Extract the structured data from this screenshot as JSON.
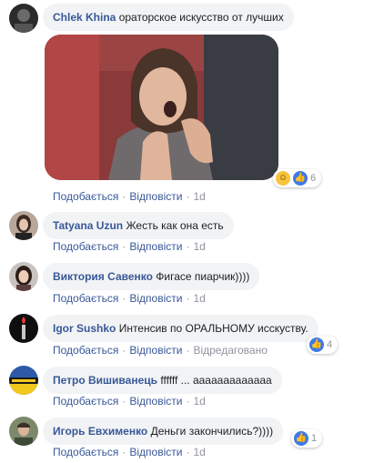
{
  "comments": [
    {
      "author": "Chlek Khina",
      "text": "ораторское искусство от лучших",
      "like_label": "Подобається",
      "reply_label": "Відповісти",
      "time": "1d",
      "reactions_count": "6",
      "reaction_icons": [
        "haha-icon",
        "like-icon"
      ]
    },
    {
      "author": "Tatyana Uzun",
      "text": "Жесть как она есть",
      "like_label": "Подобається",
      "reply_label": "Відповісти",
      "time": "1d"
    },
    {
      "author": "Виктория Савенко",
      "text": "Фигасе пиарчик))))",
      "like_label": "Подобається",
      "reply_label": "Відповісти",
      "time": "1d"
    },
    {
      "author": "Igor Sushko",
      "text": "Интенсив по ОРАЛЬНОМУ исскуству.",
      "like_label": "Подобається",
      "reply_label": "Відповісти",
      "edited_label": "Відредаговано",
      "reactions_count": "4",
      "reaction_icons": [
        "like-icon"
      ]
    },
    {
      "author": "Петро Вишиванець",
      "text": "ffffff ... ааааааааааааа",
      "like_label": "Подобається",
      "reply_label": "Відповісти",
      "time": "1d"
    },
    {
      "author": "Игорь Евхименко",
      "text": "Деньги закончились?))))",
      "like_label": "Подобається",
      "reply_label": "Відповісти",
      "time": "1d",
      "reactions_count": "1",
      "reaction_icons": [
        "like-icon"
      ]
    }
  ],
  "colors": {
    "link": "#385898",
    "bubble": "#f2f3f5",
    "meta": "#90949c",
    "like": "#3f7ae8",
    "haha": "#f7c43d"
  }
}
